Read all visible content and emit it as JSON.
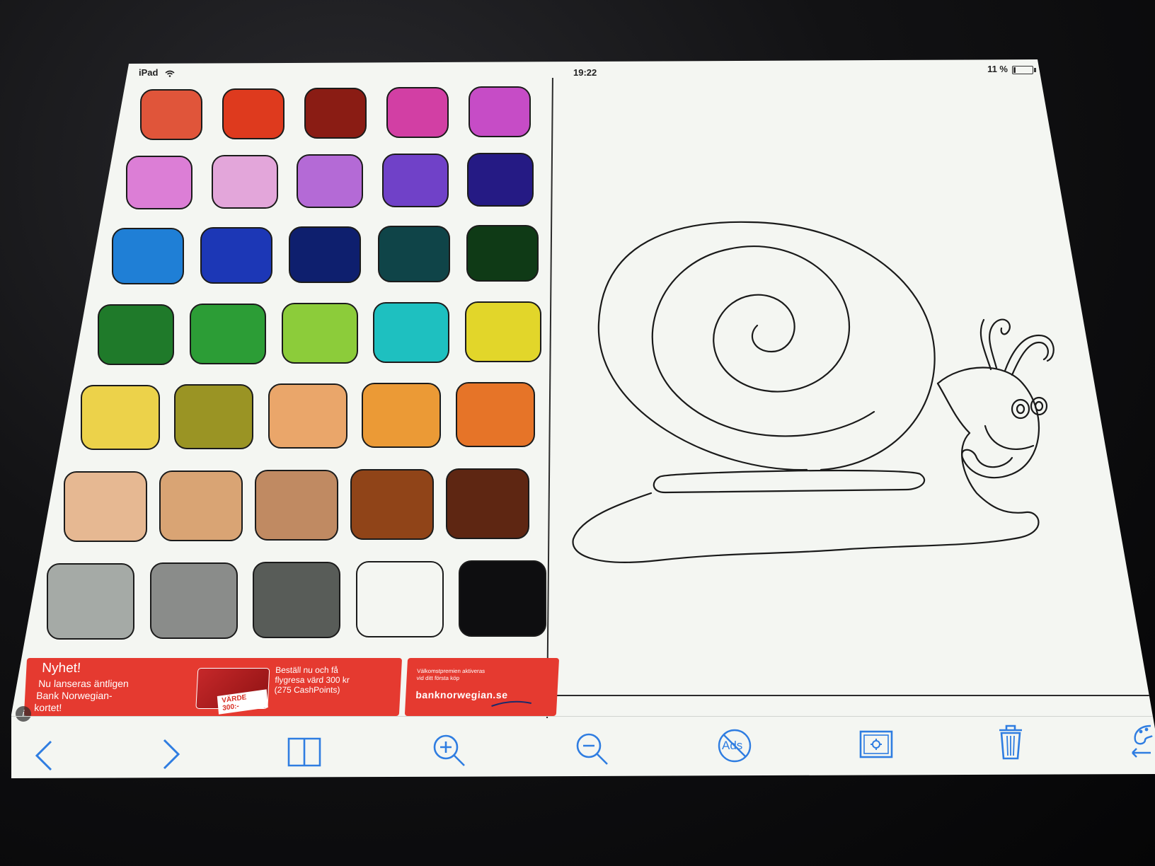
{
  "status_bar": {
    "device": "iPad",
    "time": "19:22",
    "battery": "11 %"
  },
  "palette": {
    "rows": [
      [
        "#e0553a",
        "#de3a1e",
        "#8a1c14",
        "#d23fa4",
        "#c64cc6"
      ],
      [
        "#dc7ed6",
        "#e3a6da",
        "#b46ad6",
        "#7041c8",
        "#251a84"
      ],
      [
        "#1f7fd6",
        "#1c37b6",
        "#0e1f6e",
        "#0f4448",
        "#0f3a16"
      ],
      [
        "#1f7a2a",
        "#2c9d36",
        "#8ccc3a",
        "#1ec0c0",
        "#e2d62a"
      ],
      [
        "#ecd24a",
        "#9a9424",
        "#eaa66a",
        "#eb9a36",
        "#e67428"
      ],
      [
        "#e6b892",
        "#d9a474",
        "#c08a62",
        "#904418",
        "#5e2612"
      ],
      [
        "#a5aaa6",
        "#8a8c8a",
        "#585c58",
        "#f4f6f2",
        "#0e0e10"
      ]
    ]
  },
  "ad": {
    "title": "Nyhet!",
    "line1": "Nu lanseras äntligen",
    "line2": "Bank Norwegian-",
    "line3": "kortet!",
    "offer1": "Beställ nu och få",
    "offer2": "flygresa värd 300 kr",
    "offer3": "(275 CashPoints)",
    "card_badge": "VÄRDE 300:-",
    "small1": "Välkomstpremien aktiveras",
    "small2": "vid ditt första köp",
    "brand": "banknorwegian.se"
  },
  "toolbar": {
    "ads_label": "Ads"
  },
  "colors": {
    "accent": "#2f7de1",
    "ad_red": "#e53a30"
  }
}
